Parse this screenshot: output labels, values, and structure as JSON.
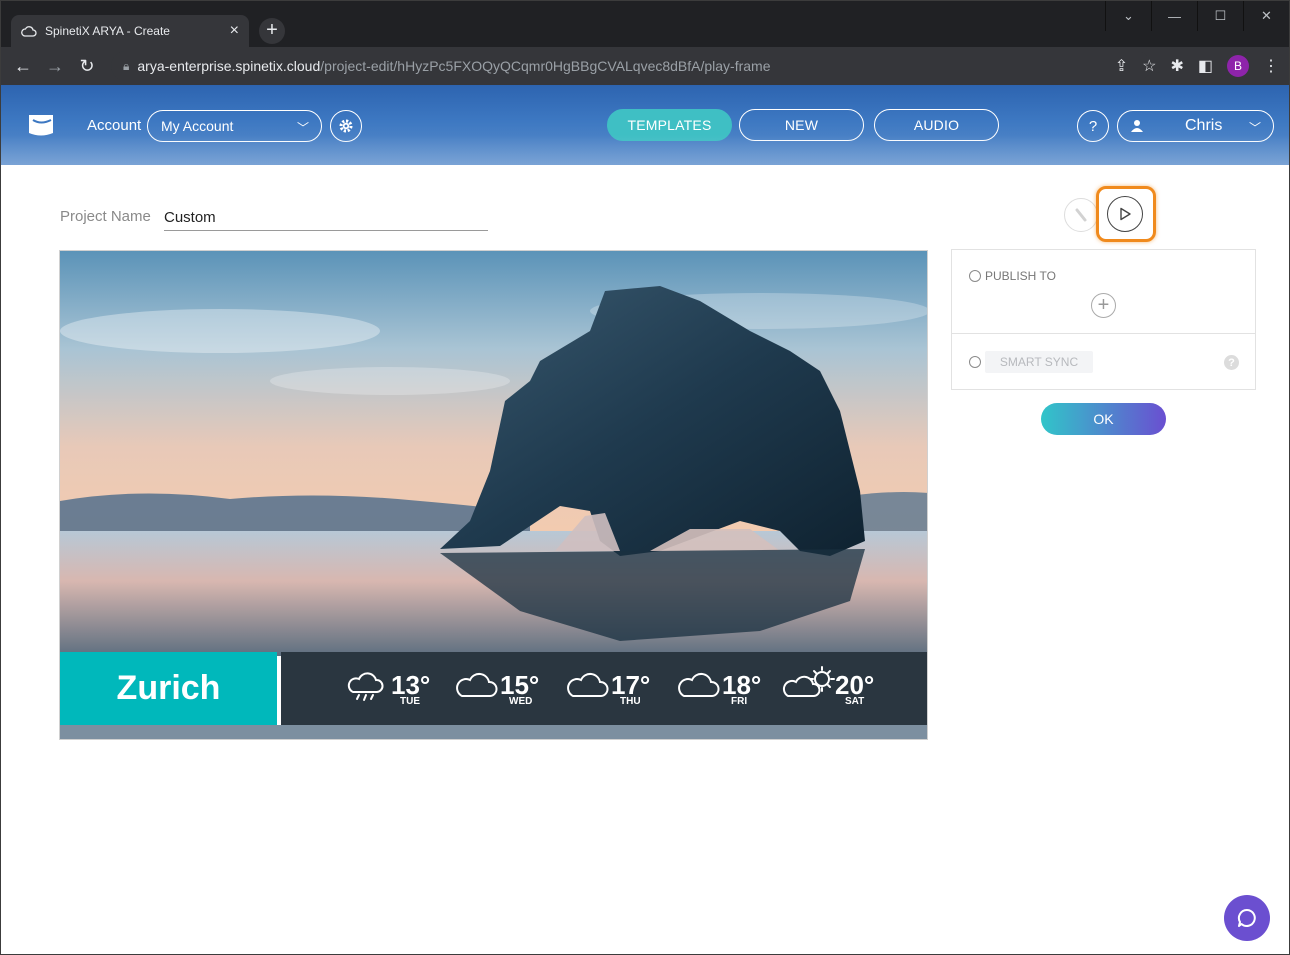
{
  "browser": {
    "tab_title": "SpinetiX ARYA - Create",
    "tab_close": "×",
    "new_tab": "+",
    "url_host": "arya-enterprise.spinetix.cloud",
    "url_path": "/project-edit/hHyzPc5FXOQyQCqmr0HgBBgCVALqvec8dBfA/play-frame",
    "profile_initial": "B"
  },
  "header": {
    "account_label": "Account",
    "account_value": "My Account",
    "nav": [
      {
        "label": "TEMPLATES",
        "active": true
      },
      {
        "label": "NEW",
        "active": false
      },
      {
        "label": "AUDIO",
        "active": false
      }
    ],
    "help": "?",
    "user_name": "Chris"
  },
  "project": {
    "name_label": "Project Name",
    "name_value": "Custom"
  },
  "preview": {
    "city": "Zurich",
    "forecast": [
      {
        "temp": "13°",
        "day": "TUE",
        "icon": "rain-cloud-icon"
      },
      {
        "temp": "15°",
        "day": "WED",
        "icon": "cloud-icon"
      },
      {
        "temp": "17°",
        "day": "THU",
        "icon": "cloud-icon"
      },
      {
        "temp": "18°",
        "day": "FRI",
        "icon": "cloud-icon"
      },
      {
        "temp": "20°",
        "day": "SAT",
        "icon": "partly-sunny-icon"
      }
    ]
  },
  "publish": {
    "publish_to": "PUBLISH TO",
    "add": "+",
    "smart_sync": "SMART SYNC",
    "help": "?",
    "ok": "OK"
  },
  "colors": {
    "accent_teal": "#00b8bb",
    "highlight_orange": "#f08a1d",
    "chat_purple": "#6b4fd0"
  }
}
